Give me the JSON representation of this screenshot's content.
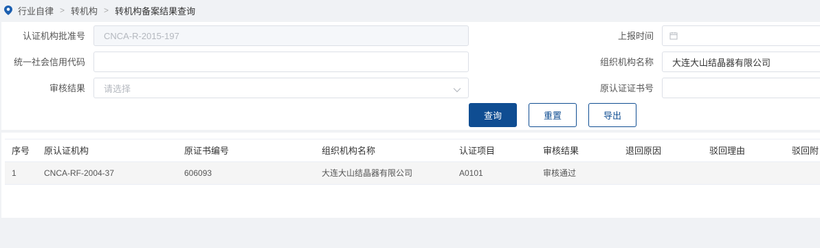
{
  "breadcrumb": {
    "items": [
      "行业自律",
      "转机构",
      "转机构备案结果查询"
    ]
  },
  "form": {
    "approval_no": {
      "label": "认证机构批准号",
      "value": "CNCA-R-2015-197"
    },
    "report_time": {
      "label": "上报时间",
      "value": ""
    },
    "credit_code": {
      "label": "统一社会信用代码",
      "value": ""
    },
    "org_name": {
      "label": "组织机构名称",
      "value": "大连大山结晶器有限公司"
    },
    "review_result": {
      "label": "审核结果",
      "placeholder": "请选择"
    },
    "original_cert_no": {
      "label": "原认证证书号",
      "value": ""
    }
  },
  "buttons": {
    "query": "查询",
    "reset": "重置",
    "export": "导出"
  },
  "table": {
    "columns": [
      "序号",
      "原认证机构",
      "原证书编号",
      "组织机构名称",
      "认证项目",
      "审核结果",
      "退回原因",
      "驳回理由",
      "驳回附"
    ],
    "rows": [
      [
        "1",
        "CNCA-RF-2004-37",
        "606093",
        "大连大山结晶器有限公司",
        "A0101",
        "审核通过",
        "",
        "",
        ""
      ]
    ]
  },
  "colors": {
    "primary": "#0f4d92",
    "accent_pin": "#1c5fb0"
  },
  "icons": {
    "location": "location-pin-icon",
    "calendar": "calendar-icon",
    "dropdown": "chevron-down-icon"
  }
}
